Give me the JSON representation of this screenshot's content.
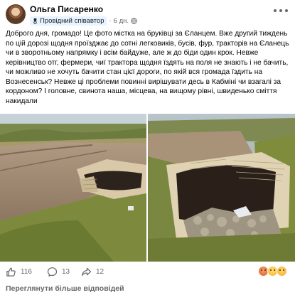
{
  "post": {
    "author": "Ольга Писаренко",
    "badge": "Провідний співавтор",
    "separator": "·",
    "time": "6 дн.",
    "audience_icon": "globe-icon",
    "text": "Доброго дня, громадо! Це фото містка на бруківці за Єланцем. Вже другий тиждень по цій дорозі щодня проїзджає до сотні легковиків, бусів, фур, тракторів на Єланець чи в зворотньому напрямку і всім байдуже, але ж до біди один крок. Невже керівництво отг, фермери, чиї трактора щодня їздять на поля не знають і не бачить, чи можливо не хочуть бачити стан цієї дороги, по якій вся громада їздить на Вознесенськ? Невже ці проблеми повинні вирішувати десь в Кабміні чи взагалі за кордоном?  І головне, свинота наша, місцева, на вищому рівні, швиденько сміття накидали"
  },
  "photos": [
    {
      "name": "collapsed-bridge-photo-1"
    },
    {
      "name": "collapsed-bridge-photo-2"
    }
  ],
  "reactions": {
    "likes": "116",
    "comments": "13",
    "shares": "12",
    "emoji": [
      "angry",
      "sad",
      "wow"
    ]
  },
  "footer": {
    "view_more": "Переглянути більше відповідей"
  },
  "colors": {
    "text": "#050505",
    "muted": "#65676b",
    "badge_bg": "#e7f3ff"
  }
}
